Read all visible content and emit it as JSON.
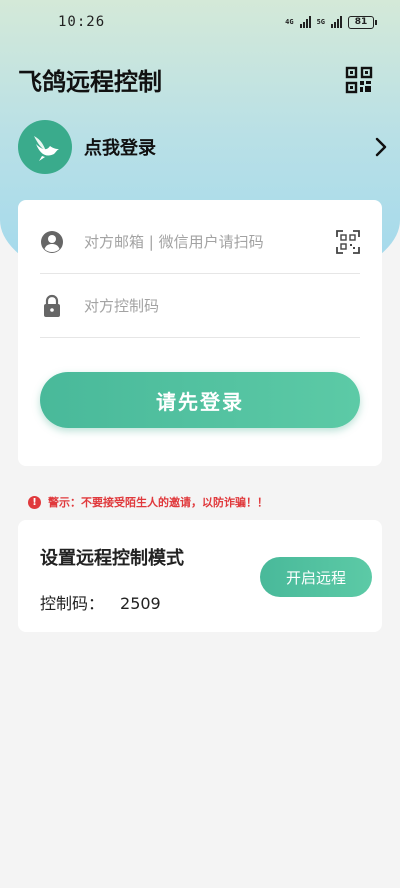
{
  "status_bar": {
    "time": "10:26",
    "network1": "4G",
    "network2": "5G",
    "battery": "81"
  },
  "header": {
    "title": "飞鸽远程控制",
    "scan_icon": "qr-scan-icon"
  },
  "login_row": {
    "label": "点我登录",
    "avatar_icon": "bird-logo-icon",
    "chevron_icon": "chevron-right-icon"
  },
  "login_form": {
    "email_placeholder": "对方邮箱 | 微信用户请扫码",
    "code_placeholder": "对方控制码",
    "submit_label": "请先登录"
  },
  "warning": {
    "icon": "alert-icon",
    "text": "警示：不要接受陌生人的邀请，以防诈骗！！"
  },
  "remote_mode": {
    "title": "设置远程控制模式",
    "code_label": "控制码：",
    "code_value": "2509",
    "button_label": "开启远程"
  },
  "colors": {
    "accent": "#4dbd9c",
    "warning": "#e0393c",
    "header_gradient_top": "#d4e9d8",
    "header_gradient_bottom": "#9fd8ee"
  }
}
